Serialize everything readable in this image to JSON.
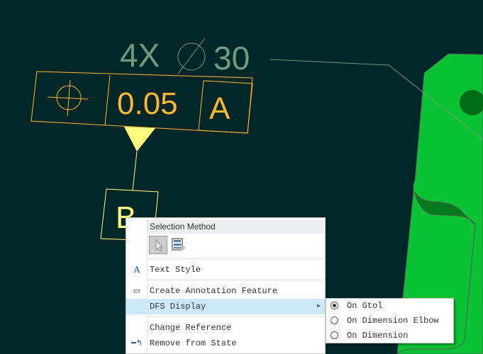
{
  "drawing": {
    "dimension_prefix": "4X",
    "dimension_value": "30",
    "tolerance_value": "0.05",
    "datum_ref": "A",
    "datum_label": "B",
    "colors": {
      "background": "#002628",
      "gtol": "#ffb833",
      "datum": "#ffff80",
      "dimension": "#6b9e7f",
      "part": "#0ac334"
    }
  },
  "context_menu": {
    "header": "Selection Method",
    "items": [
      {
        "label": "Text Style",
        "icon": "text-style-icon"
      },
      {
        "label": "Create Annotation Feature",
        "icon": "annotation-feature-icon"
      },
      {
        "label": "DFS Display",
        "icon": "",
        "has_submenu": true
      },
      {
        "label": "Change Reference",
        "icon": ""
      },
      {
        "label": "Remove from State",
        "icon": "remove-from-state-icon"
      }
    ]
  },
  "submenu": {
    "items": [
      {
        "label": "On Gtol",
        "selected": true
      },
      {
        "label": "On Dimension Elbow",
        "selected": false
      },
      {
        "label": "On Dimension",
        "selected": false
      }
    ]
  }
}
